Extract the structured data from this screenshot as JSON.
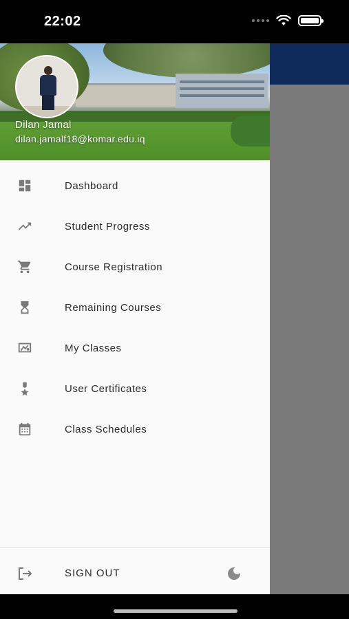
{
  "status_bar": {
    "time": "22:02",
    "icons": [
      "signal-dots-icon",
      "wifi-icon",
      "battery-icon"
    ]
  },
  "colors": {
    "app_bar": "#0e2a5a",
    "scrim": "#7a7a7a",
    "drawer_bg": "#fafafa",
    "icon": "#7a7a7a",
    "text": "#2b2b2b"
  },
  "user": {
    "name": "Dilan Jamal",
    "email": "dilan.jamalf18@komar.edu.iq"
  },
  "menu": [
    {
      "label": "Dashboard",
      "icon": "dashboard-icon"
    },
    {
      "label": "Student Progress",
      "icon": "trending-up-icon"
    },
    {
      "label": "Course Registration",
      "icon": "shopping-cart-icon"
    },
    {
      "label": "Remaining Courses",
      "icon": "hourglass-icon"
    },
    {
      "label": "My Classes",
      "icon": "classroom-icon"
    },
    {
      "label": "User Certificates",
      "icon": "certificate-icon"
    },
    {
      "label": "Class Schedules",
      "icon": "calendar-icon"
    }
  ],
  "footer": {
    "signout_label": "SIGN OUT",
    "signout_icon": "logout-icon",
    "theme_icon": "moon-icon"
  }
}
